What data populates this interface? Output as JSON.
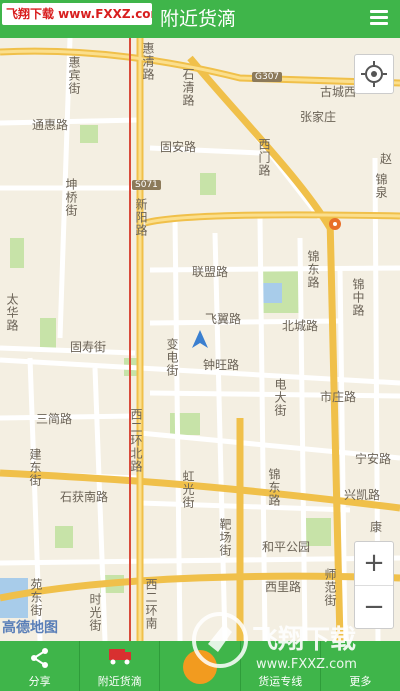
{
  "header": {
    "watermark": "飞翔下载 www.FXXZ.com",
    "title": "附近货滴",
    "menu_icon": "hamburger-menu-icon"
  },
  "map": {
    "road_labels": {
      "huiqing": "惠清路",
      "huibin": "惠宾街",
      "tong_hui": "通惠路",
      "gu_an": "固安路",
      "kunqiao": "坤桥街",
      "zhang_jia_zhuang": "张家庄",
      "gu_cheng": "古城西",
      "shi_qing": "石清路",
      "xinyang": "新阳路",
      "lian_meng": "联盟路",
      "fei_yi": "飞翼路",
      "zhong_wang": "钟旺路",
      "bian_dian": "变电街",
      "bei_cheng": "北城路",
      "jin_dong": "锦东路",
      "jin_zhong": "锦中路",
      "tai_hua": "太华路",
      "gu_shou": "固寿街",
      "dian_da": "电大街",
      "shi_zhuang": "市庄路",
      "san_jian": "三简路",
      "jian_dong": "建东街",
      "shi_huo_nan": "石获南路",
      "hong_guang": "虹光街",
      "ning_an": "宁安路",
      "xing_kai": "兴凯路",
      "ba_chang": "靶场街",
      "he_ping_park": "和平公园",
      "xi_er_huan_bei": "西二环北路",
      "xi_er_huan_nan": "西二环南",
      "shi_fan": "师范街",
      "xi_li": "西里路",
      "yuan_dong": "苑东街",
      "shi_guang": "时光街",
      "jin_bao": "锦泉",
      "xi_mian": "西门路",
      "zhao": "赵",
      "kang": "康"
    },
    "shields": {
      "g307": "G307",
      "s071": "S071"
    },
    "logo": "高德地图",
    "zoom_in": "+",
    "zoom_out": "−"
  },
  "bottom_nav": {
    "items": [
      {
        "label": "分享",
        "icon": "share-icon"
      },
      {
        "label": "附近货滴",
        "icon": "truck-icon"
      },
      {
        "label": "",
        "icon": "order-icon"
      },
      {
        "label": "货运专线",
        "icon": "route-icon"
      },
      {
        "label": "更多",
        "icon": "more-icon"
      }
    ]
  },
  "watermark_bottom": {
    "text": "飞翔下载",
    "url": "www.FXXZ.com"
  },
  "colors": {
    "accent": "#3fb54a",
    "map_bg": "#f4efe2",
    "major_road": "#f5c243",
    "secondary_road": "#ffffff"
  }
}
